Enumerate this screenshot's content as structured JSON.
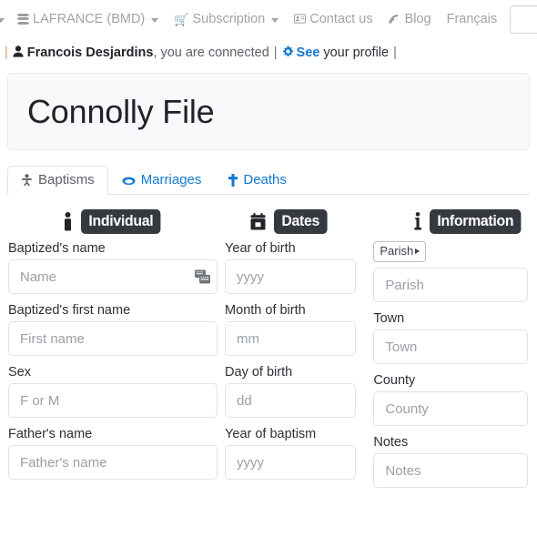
{
  "navbar": {
    "items": [
      {
        "label": "",
        "icon": "chevron-down-icon",
        "has_caret": true,
        "truncated": true
      },
      {
        "label": "LAFRANCE (BMD)",
        "icon": "database-icon",
        "has_caret": true
      },
      {
        "label": "Subscription",
        "icon": "shopping-cart-icon",
        "has_caret": true
      },
      {
        "label": "Contact us",
        "icon": "address-card-icon",
        "has_caret": false
      },
      {
        "label": "Blog",
        "icon": "blog-rss-icon",
        "has_caret": false
      },
      {
        "label": "Français",
        "icon": "",
        "has_caret": false
      }
    ]
  },
  "userbar": {
    "separator": "|",
    "user_icon": "user-icon",
    "user_name": "Francois Desjardins",
    "connected_text": ", you are connected",
    "separator2": "|",
    "gear_icon": "gear-icon",
    "see_link": "See",
    "profile_text": "your profile",
    "separator3": "|"
  },
  "page": {
    "title": "Connolly File"
  },
  "tabs": [
    {
      "label": "Baptisms",
      "icon": "baby-icon",
      "active": true
    },
    {
      "label": "Marriages",
      "icon": "ring-icon",
      "active": false
    },
    {
      "label": "Deaths",
      "icon": "cross-icon",
      "active": false
    }
  ],
  "sections": {
    "individual": {
      "icon": "person-icon",
      "badge": "Individual",
      "fields": [
        {
          "label": "Baptized's name",
          "placeholder": "Name",
          "value": "",
          "trailing_icon": "keyboard-icon"
        },
        {
          "label": "Baptized's first name",
          "placeholder": "First name",
          "value": ""
        },
        {
          "label": "Sex",
          "placeholder": "F or M",
          "value": ""
        },
        {
          "label": "Father's name",
          "placeholder": "Father's name",
          "value": ""
        }
      ]
    },
    "dates": {
      "icon": "calendar-icon",
      "badge": "Dates",
      "fields": [
        {
          "label": "Year of birth",
          "placeholder": "yyyy",
          "value": ""
        },
        {
          "label": "Month of birth",
          "placeholder": "mm",
          "value": ""
        },
        {
          "label": "Day of birth",
          "placeholder": "dd",
          "value": ""
        },
        {
          "label": "Year of baptism",
          "placeholder": "yyyy",
          "value": ""
        }
      ]
    },
    "information": {
      "icon": "info-icon",
      "badge": "Information",
      "dropdown_button": "Parish",
      "fields": [
        {
          "label": "",
          "placeholder": "Parish",
          "value": ""
        },
        {
          "label": "Town",
          "placeholder": "Town",
          "value": ""
        },
        {
          "label": "County",
          "placeholder": "County",
          "value": ""
        },
        {
          "label": "Notes",
          "placeholder": "Notes",
          "value": ""
        }
      ]
    }
  },
  "colors": {
    "link": "#1278d4",
    "badge_bg": "#343a40",
    "jumbotron_bg": "#f8f9fa",
    "muted": "#a0a3a7"
  }
}
